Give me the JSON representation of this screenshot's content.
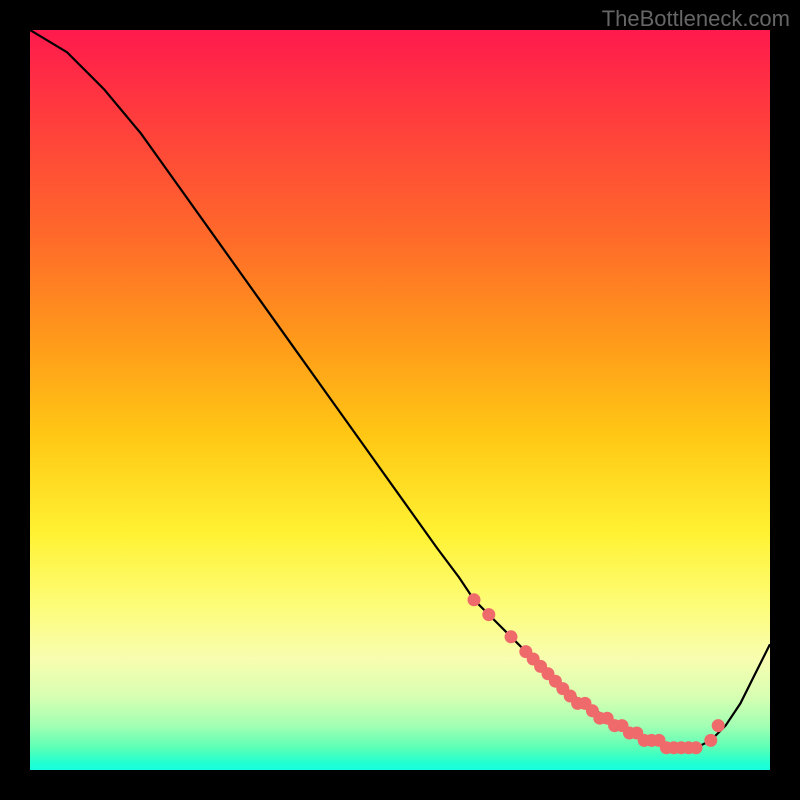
{
  "watermark": "TheBottleneck.com",
  "chart_data": {
    "type": "line",
    "title": "",
    "xlabel": "",
    "ylabel": "",
    "xlim": [
      0,
      1
    ],
    "ylim": [
      0,
      1
    ],
    "series": [
      {
        "name": "curve",
        "x": [
          0.0,
          0.05,
          0.08,
          0.1,
          0.15,
          0.2,
          0.25,
          0.3,
          0.35,
          0.4,
          0.45,
          0.5,
          0.55,
          0.58,
          0.6,
          0.63,
          0.66,
          0.69,
          0.72,
          0.75,
          0.78,
          0.8,
          0.82,
          0.84,
          0.86,
          0.88,
          0.9,
          0.92,
          0.94,
          0.96,
          0.98,
          1.0
        ],
        "y": [
          1.0,
          0.97,
          0.94,
          0.92,
          0.86,
          0.79,
          0.72,
          0.65,
          0.58,
          0.51,
          0.44,
          0.37,
          0.3,
          0.26,
          0.23,
          0.2,
          0.17,
          0.14,
          0.11,
          0.09,
          0.07,
          0.06,
          0.05,
          0.04,
          0.03,
          0.03,
          0.03,
          0.04,
          0.06,
          0.09,
          0.13,
          0.17
        ]
      }
    ],
    "markers": {
      "name": "dots",
      "x": [
        0.6,
        0.62,
        0.65,
        0.67,
        0.68,
        0.69,
        0.7,
        0.71,
        0.72,
        0.73,
        0.74,
        0.75,
        0.76,
        0.77,
        0.78,
        0.79,
        0.8,
        0.81,
        0.82,
        0.83,
        0.84,
        0.85,
        0.86,
        0.87,
        0.88,
        0.89,
        0.9,
        0.92,
        0.93
      ],
      "y": [
        0.23,
        0.21,
        0.18,
        0.16,
        0.15,
        0.14,
        0.13,
        0.12,
        0.11,
        0.1,
        0.09,
        0.09,
        0.08,
        0.07,
        0.07,
        0.06,
        0.06,
        0.05,
        0.05,
        0.04,
        0.04,
        0.04,
        0.03,
        0.03,
        0.03,
        0.03,
        0.03,
        0.04,
        0.06
      ],
      "radius": 6.5
    }
  }
}
